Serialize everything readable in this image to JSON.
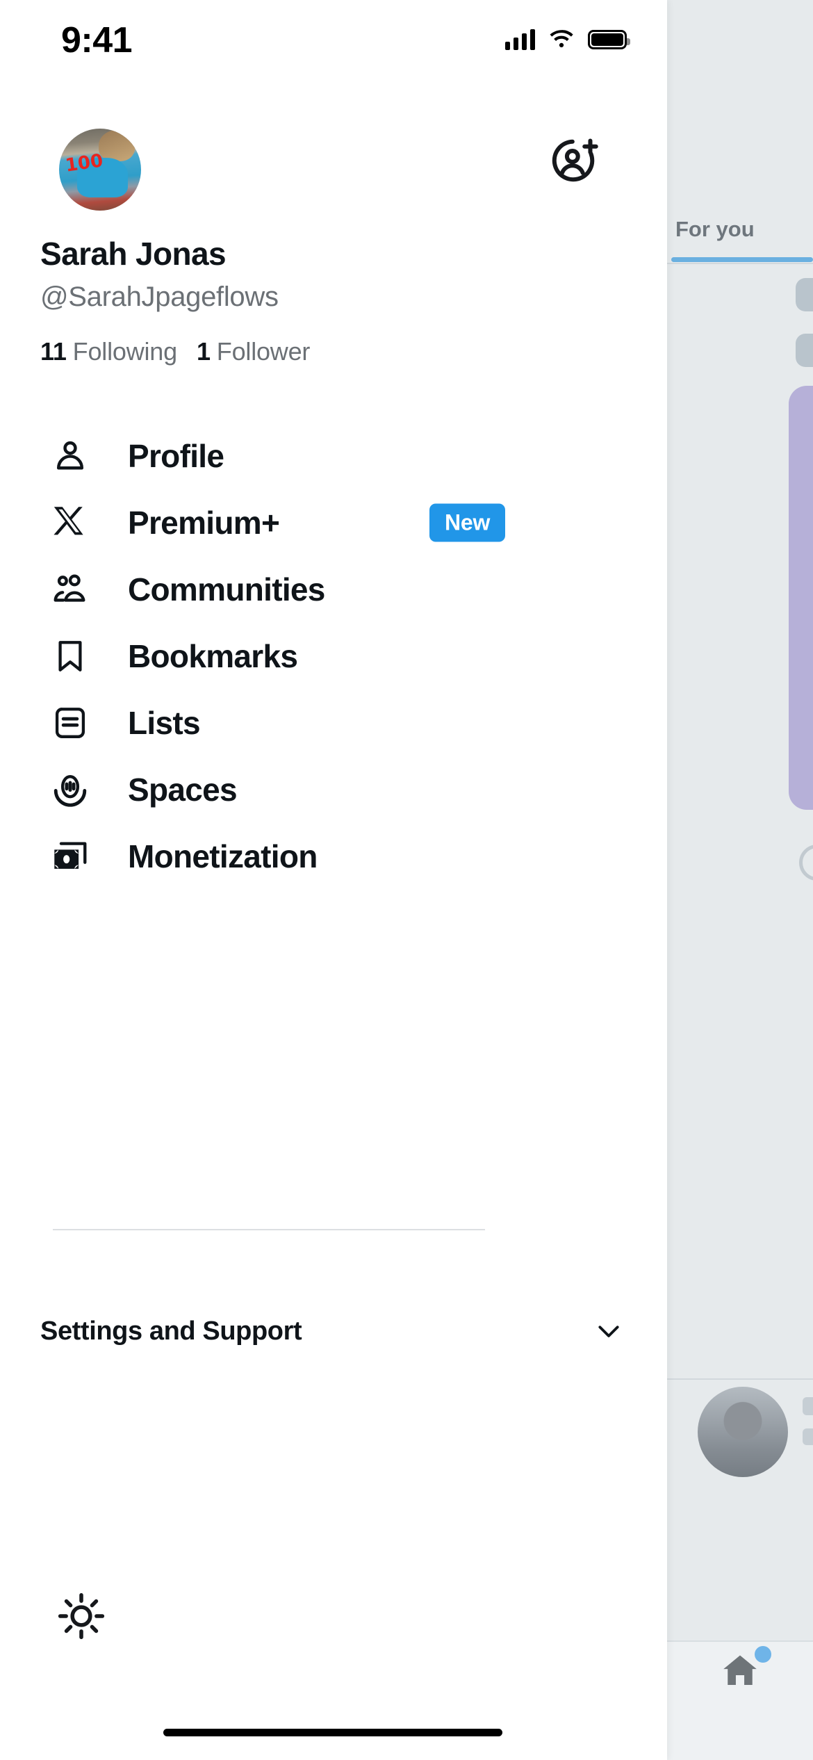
{
  "status_bar": {
    "time": "9:41",
    "signal_icon": "cellular-bars-icon",
    "wifi_icon": "wifi-icon",
    "battery_icon": "battery-icon"
  },
  "drawer": {
    "add_account_icon": "add-person-icon",
    "profile": {
      "avatar_icon": "user-avatar",
      "avatar_emoji": "100",
      "display_name": "Sarah Jonas",
      "handle": "@SarahJpageflows",
      "following_count": "11",
      "following_label": "Following",
      "followers_count": "1",
      "followers_label": "Follower"
    },
    "menu_items": [
      {
        "label": "Profile",
        "icon": "person-icon"
      },
      {
        "label": "Premium+",
        "icon": "x-logo-icon",
        "badge": "New"
      },
      {
        "label": "Communities",
        "icon": "people-icon"
      },
      {
        "label": "Bookmarks",
        "icon": "bookmark-icon"
      },
      {
        "label": "Lists",
        "icon": "list-icon"
      },
      {
        "label": "Spaces",
        "icon": "spaces-mic-icon"
      },
      {
        "label": "Monetization",
        "icon": "money-icon"
      }
    ],
    "settings": {
      "label": "Settings and Support",
      "chevron_icon": "chevron-down-icon"
    },
    "brightness_icon": "sun-brightness-icon"
  },
  "background_timeline": {
    "tab_label": "For you",
    "tab_underline_color": "#6ab0e0",
    "home_icon": "home-icon",
    "notification_dot_color": "#6fb4e8"
  },
  "colors": {
    "badge_blue": "#2196e8",
    "text_primary": "#0f1419",
    "text_secondary": "#6b7075",
    "backdrop": "#e6eaec"
  }
}
